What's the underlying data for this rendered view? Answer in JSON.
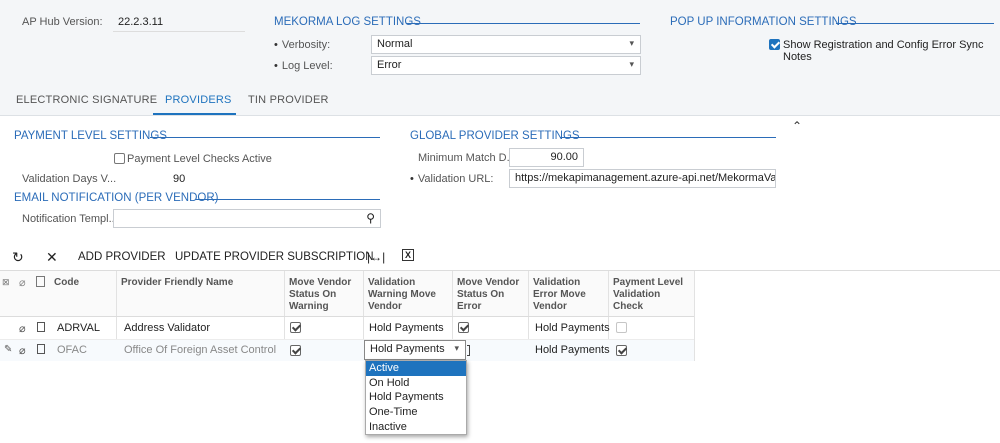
{
  "hub": {
    "version_label": "AP Hub Version:",
    "version_value": "22.2.3.11"
  },
  "log_settings": {
    "title": "MEKORMA LOG SETTINGS",
    "verbosity_label": "Verbosity:",
    "verbosity_value": "Normal",
    "log_level_label": "Log Level:",
    "log_level_value": "Error"
  },
  "popup_settings": {
    "title": "POP UP INFORMATION SETTINGS",
    "show_notes_label": "Show Registration and Config Error Sync Notes",
    "show_notes_checked": true
  },
  "tabs": [
    {
      "label": "ELECTRONIC SIGNATURE",
      "active": false
    },
    {
      "label": "PROVIDERS",
      "active": true
    },
    {
      "label": "TIN PROVIDER",
      "active": false
    }
  ],
  "payment_level": {
    "title": "PAYMENT LEVEL SETTINGS",
    "checks_active_label": "Payment Level Checks Active",
    "checks_active_checked": false,
    "validation_days_label": "Validation Days V...",
    "validation_days_value": "90"
  },
  "email_notification": {
    "title": "EMAIL NOTIFICATION (PER VENDOR)",
    "template_label": "Notification Templ...",
    "template_value": ""
  },
  "global_provider": {
    "title": "GLOBAL PROVIDER SETTINGS",
    "min_match_label": "Minimum Match D...",
    "min_match_value": "90.00",
    "validation_url_label": "Validation URL:",
    "validation_url_value": "https://mekapimanagement.azure-api.net/MekormaValidati"
  },
  "toolbar": {
    "refresh_icon": "refresh-icon",
    "clear_icon": "close-icon",
    "add_provider": "ADD PROVIDER",
    "update_subscription": "UPDATE PROVIDER SUBSCRIPTION",
    "fit_icon": "fit-columns-icon",
    "excel_icon": "excel-export-icon"
  },
  "table": {
    "columns": [
      "Code",
      "Provider Friendly Name",
      "Move Vendor Status On Warning",
      "Validation Warning Move Vendor",
      "Move Vendor Status On Error",
      "Validation Error Move Vendor",
      "Payment Level Validation Check"
    ],
    "rows": [
      {
        "code": "ADRVAL",
        "name": "Address Validator",
        "move_on_warning": true,
        "warning_move": "Hold Payments",
        "move_on_error": true,
        "error_move": "Hold Payments",
        "payment_check": false
      },
      {
        "code": "OFAC",
        "name": "Office Of Foreign Asset Control",
        "move_on_warning": true,
        "warning_move": "Hold Payments",
        "move_on_error": true,
        "error_move": "Hold Payments",
        "payment_check": true
      }
    ]
  },
  "dropdown_options": [
    "Active",
    "On Hold",
    "Hold Payments",
    "One-Time",
    "Inactive"
  ],
  "dropdown_selected": "Active",
  "colors": {
    "accent": "#1e73be",
    "section": "#2b6cb8",
    "panel_bg": "#f4f6f8"
  }
}
